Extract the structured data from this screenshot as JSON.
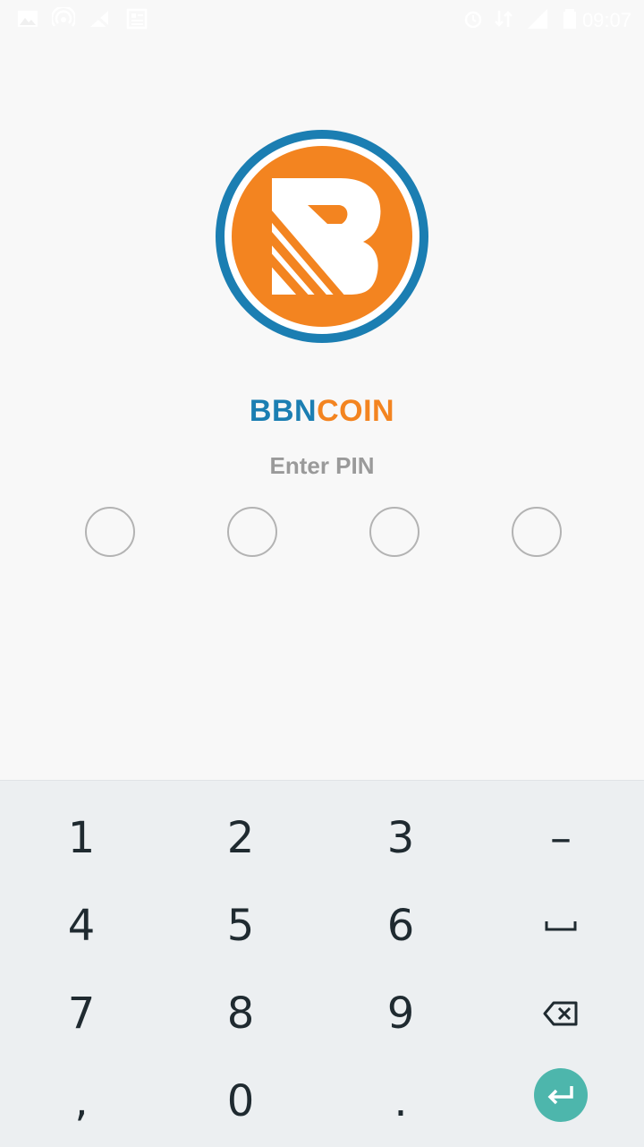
{
  "status_bar": {
    "time": "09:07",
    "icons": [
      "image-icon",
      "hotspot-icon",
      "no-signal-icon",
      "news-icon",
      "alarm-icon",
      "data-icon",
      "signal-icon",
      "battery-icon"
    ]
  },
  "app": {
    "brand_part1": "BBN",
    "brand_part2": "COIN",
    "subtitle": "Enter PIN",
    "colors": {
      "blue": "#1b7eb2",
      "orange": "#f38420",
      "accent": "#4db6ac"
    }
  },
  "pin": {
    "length": 4,
    "entered": 0
  },
  "keyboard": {
    "keys": [
      {
        "label": "1"
      },
      {
        "label": "2"
      },
      {
        "label": "3"
      },
      {
        "label": "–"
      },
      {
        "label": "4"
      },
      {
        "label": "5"
      },
      {
        "label": "6"
      },
      {
        "icon": "space-icon"
      },
      {
        "label": "7"
      },
      {
        "label": "8"
      },
      {
        "label": "9"
      },
      {
        "icon": "backspace-icon"
      },
      {
        "label": ","
      },
      {
        "label": "0"
      },
      {
        "label": "."
      },
      {
        "icon": "enter-icon"
      }
    ]
  }
}
